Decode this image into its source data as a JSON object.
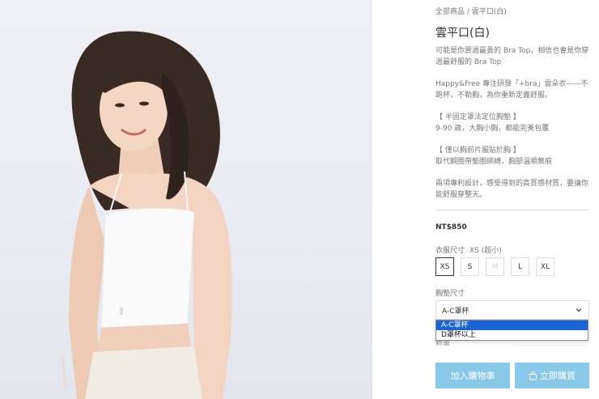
{
  "breadcrumb": "全部商品 / 雲平口(白)",
  "product": {
    "title": "雲平口(白)",
    "description": [
      "可能是你買過最貴的 Bra Top，相信也會是你穿過最舒服的 Bra Top",
      "Happy&Free 專注研發「+bra」雲朵衣——不跑杯，不勒胸，為你重新定義舒服。",
      "【 半固定罩法定位胸墊 】\n9-90 歲，大胸小胸，都能完美包覆",
      "【 僅以胸前片服貼於胸 】\n取代鋼圈帶墊圈綁縛，胸部溫順無痕",
      "兩項專利設計，感受得到的高質感材質，要讓你能舒服穿整天。"
    ],
    "price": "NT$850"
  },
  "size": {
    "label": "衣服尺寸",
    "selected_text": "XS (超小)",
    "options": [
      "XS",
      "S",
      "M",
      "L",
      "XL"
    ]
  },
  "cup": {
    "label": "胸墊尺寸",
    "selected": "A-C罩杯",
    "options": [
      "A-C罩杯",
      "D罩杯以上"
    ]
  },
  "quantity": {
    "label": "數量"
  },
  "buttons": {
    "add_to_cart": "加入購物車",
    "buy_now": "立即購買"
  },
  "colors": {
    "button_bg": "#88c8e8",
    "dropdown_highlight": "#1a64d6"
  }
}
